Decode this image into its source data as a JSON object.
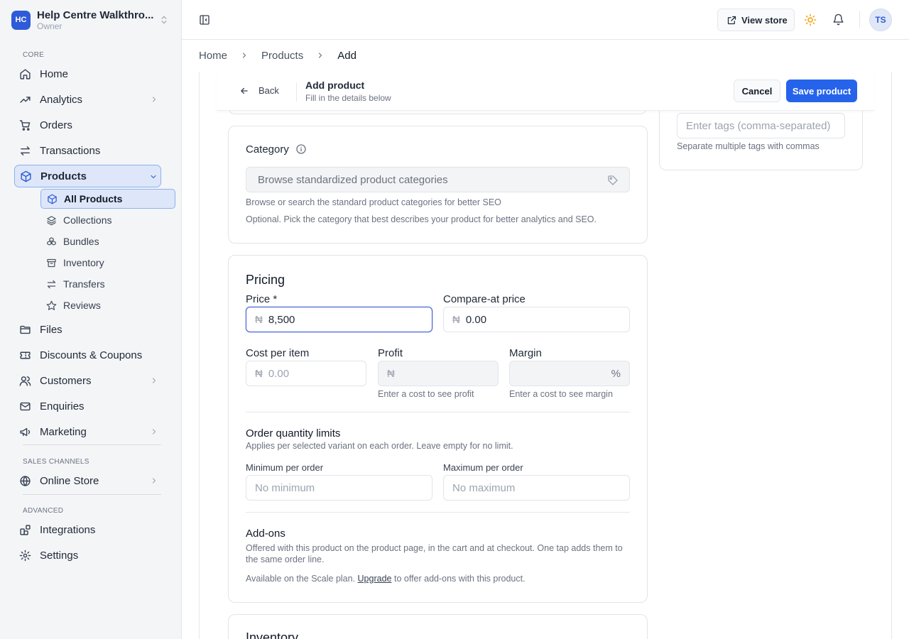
{
  "workspace": {
    "initials": "HC",
    "name": "Help Centre Walkthro...",
    "role": "Owner"
  },
  "sidebar": {
    "sections": {
      "core": "CORE",
      "sales": "SALES CHANNELS",
      "advanced": "ADVANCED"
    },
    "items": {
      "home": "Home",
      "analytics": "Analytics",
      "orders": "Orders",
      "transactions": "Transactions",
      "products": "Products",
      "files": "Files",
      "discounts": "Discounts & Coupons",
      "customers": "Customers",
      "enquiries": "Enquiries",
      "marketing": "Marketing",
      "online_store": "Online Store",
      "integrations": "Integrations",
      "settings": "Settings"
    },
    "product_sub": {
      "all_products": "All Products",
      "collections": "Collections",
      "bundles": "Bundles",
      "inventory": "Inventory",
      "transfers": "Transfers",
      "reviews": "Reviews"
    }
  },
  "header": {
    "view_store": "View store",
    "avatar": "TS"
  },
  "breadcrumb": {
    "home": "Home",
    "products": "Products",
    "current": "Add"
  },
  "actionbar": {
    "back": "Back",
    "title": "Add product",
    "subtitle": "Fill in the details below",
    "cancel": "Cancel",
    "save": "Save product"
  },
  "tags": {
    "placeholder": "Enter tags (comma-separated)",
    "help": "Separate multiple tags with commas"
  },
  "category": {
    "label": "Category",
    "placeholder": "Browse standardized product categories",
    "help1": "Browse or search the standard product categories for better SEO",
    "help2": "Optional. Pick the category that best describes your product for better analytics and SEO."
  },
  "pricing": {
    "title": "Pricing",
    "currency": "₦",
    "price_label": "Price *",
    "price_value": "8,500",
    "compare_label": "Compare-at price",
    "compare_value": "0.00",
    "cost_label": "Cost per item",
    "cost_placeholder": "0.00",
    "profit_label": "Profit",
    "profit_help": "Enter a cost to see profit",
    "margin_label": "Margin",
    "margin_unit": "%",
    "margin_help": "Enter a cost to see margin"
  },
  "order_limits": {
    "title": "Order quantity limits",
    "description": "Applies per selected variant on each order. Leave empty for no limit.",
    "min_label": "Minimum per order",
    "min_placeholder": "No minimum",
    "max_label": "Maximum per order",
    "max_placeholder": "No maximum"
  },
  "addons": {
    "title": "Add-ons",
    "description": "Offered with this product on the product page, in the cart and at checkout. One tap adds them to the same order line.",
    "plan_prefix": "Available on the Scale plan.",
    "upgrade": "Upgrade",
    "plan_suffix": "to offer add-ons with this product."
  },
  "inventory": {
    "title": "Inventory"
  }
}
